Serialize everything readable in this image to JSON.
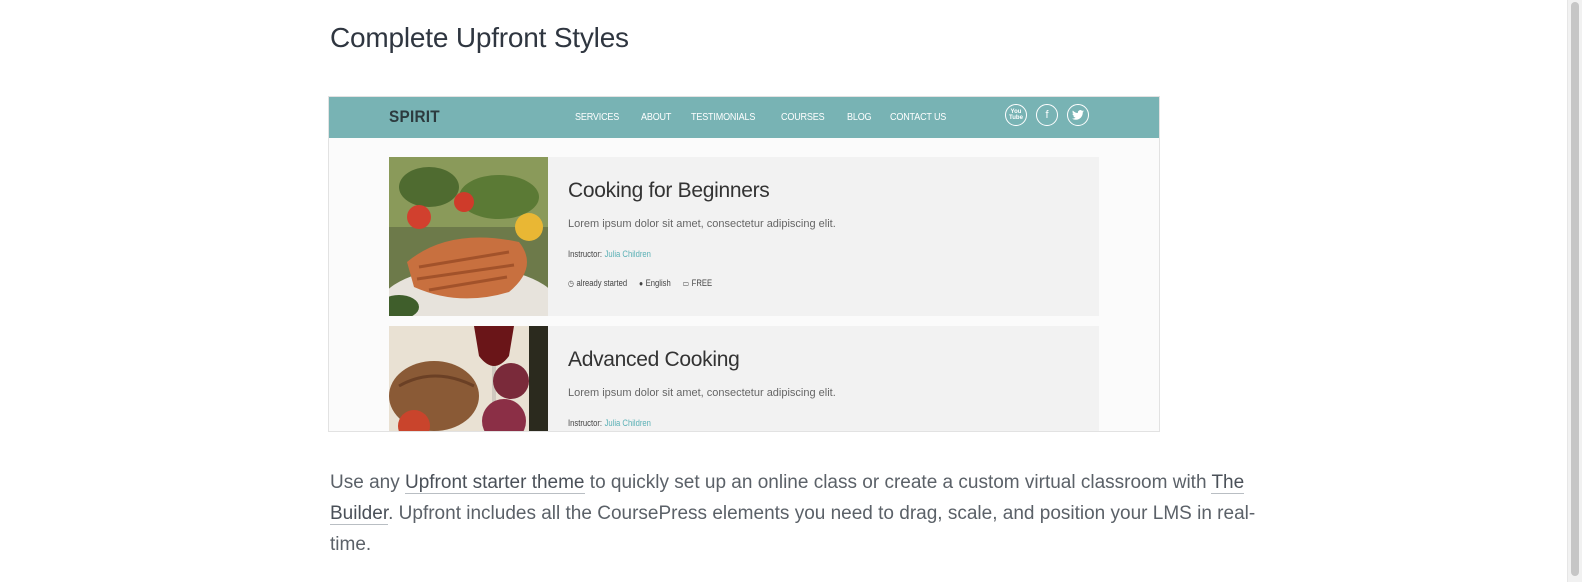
{
  "page": {
    "title": "Complete Upfront Styles"
  },
  "screenshot": {
    "logo": "SPIRIT",
    "menu": [
      "SERVICES",
      "ABOUT",
      "TESTIMONIALS",
      "COURSES",
      "BLOG",
      "CONTACT US"
    ],
    "social_icons": [
      "youtube-icon",
      "facebook-icon",
      "twitter-icon"
    ],
    "nav_color": "#78b3b4",
    "courses": [
      {
        "title": "Cooking for Beginners",
        "description": "Lorem ipsum dolor sit amet, consectetur adipiscing elit.",
        "instructor_label": "Instructor:",
        "instructor_name": "Julia Children",
        "status": "already started",
        "language": "English",
        "price": "FREE"
      },
      {
        "title": "Advanced Cooking",
        "description": "Lorem ipsum dolor sit amet, consectetur adipiscing elit.",
        "instructor_label": "Instructor:",
        "instructor_name": "Julia Children"
      }
    ]
  },
  "body": {
    "text_1": "Use any ",
    "link_1": "Upfront starter theme",
    "text_2": " to quickly set up an online class or create a custom virtual classroom with ",
    "link_2": "The Builder",
    "text_3": ". Upfront includes all the CoursePress elements you need to drag, scale, and position your LMS in real-time."
  }
}
